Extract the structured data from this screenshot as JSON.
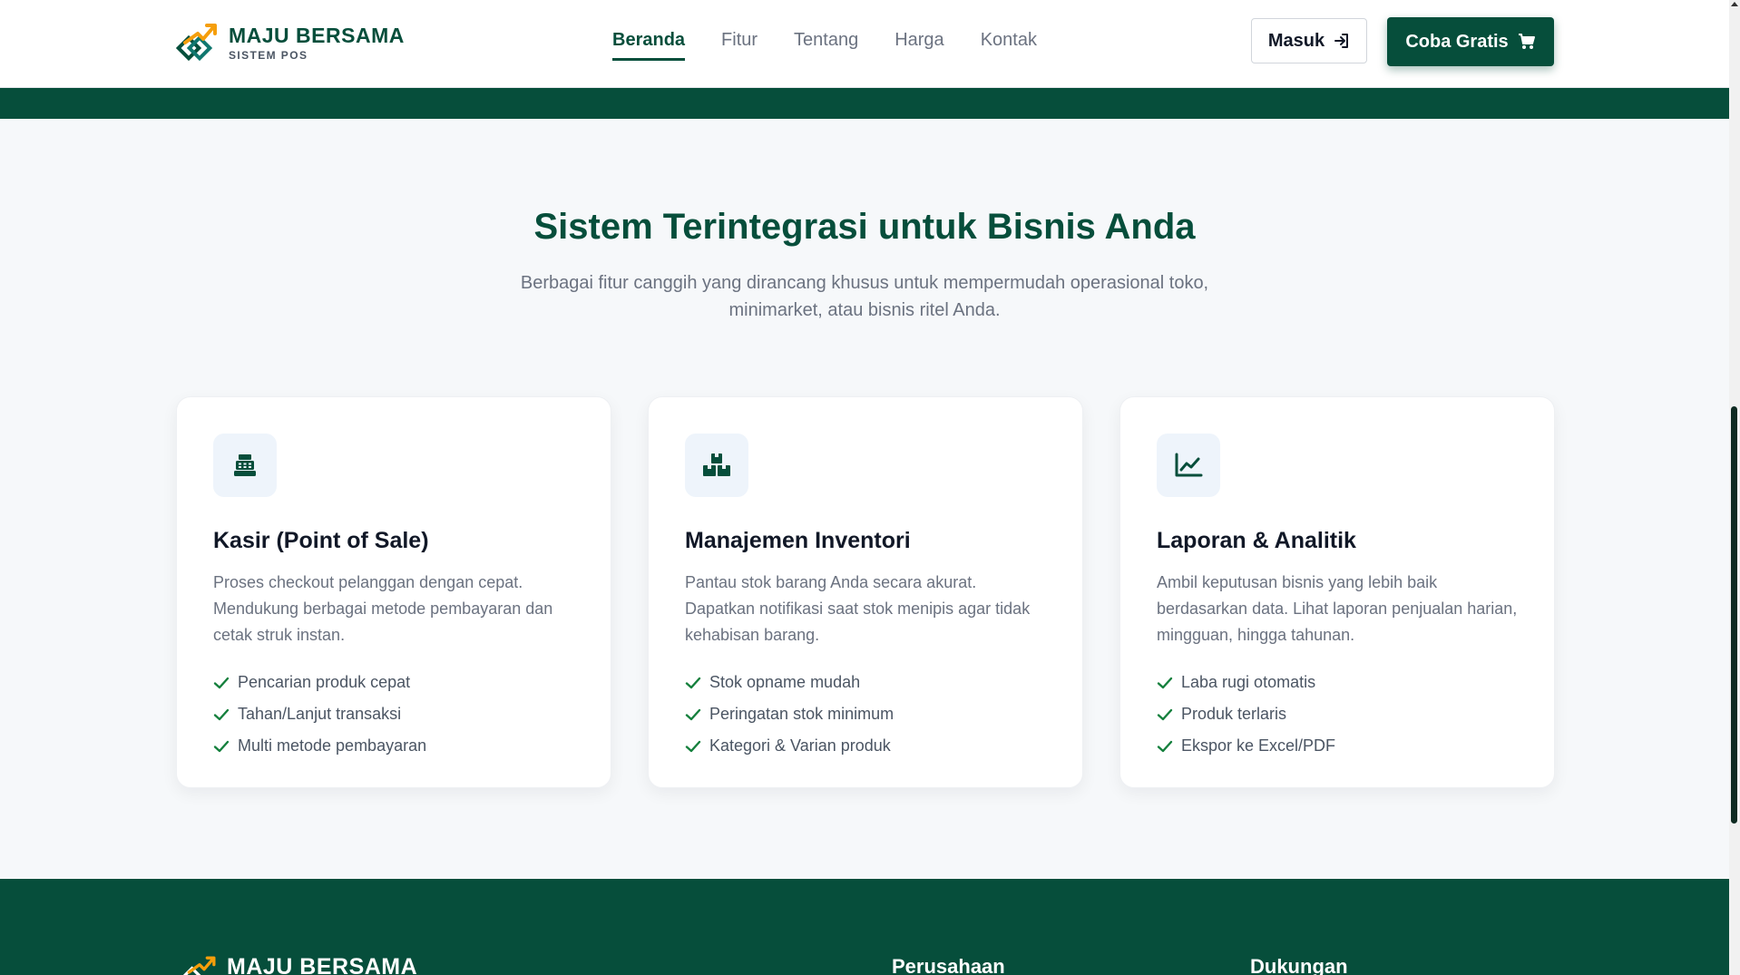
{
  "brand": {
    "name": "MAJU BERSAMA",
    "subtitle": "SISTEM POS"
  },
  "nav": {
    "items": [
      {
        "label": "Beranda",
        "active": true
      },
      {
        "label": "Fitur",
        "active": false
      },
      {
        "label": "Tentang",
        "active": false
      },
      {
        "label": "Harga",
        "active": false
      },
      {
        "label": "Kontak",
        "active": false
      }
    ],
    "login_label": "Masuk",
    "trial_label": "Coba Gratis"
  },
  "section": {
    "title": "Sistem Terintegrasi untuk Bisnis Anda",
    "description": "Berbagai fitur canggih yang dirancang khusus untuk mempermudah operasional toko, minimarket, atau bisnis ritel Anda."
  },
  "cards": [
    {
      "icon": "cash-register-icon",
      "title": "Kasir (Point of Sale)",
      "description": "Proses checkout pelanggan dengan cepat. Mendukung berbagai metode pembayaran dan cetak struk instan.",
      "features": [
        "Pencarian produk cepat",
        "Tahan/Lanjut transaksi",
        "Multi metode pembayaran"
      ]
    },
    {
      "icon": "boxes-icon",
      "title": "Manajemen Inventori",
      "description": "Pantau stok barang Anda secara akurat. Dapatkan notifikasi saat stok menipis agar tidak kehabisan barang.",
      "features": [
        "Stok opname mudah",
        "Peringatan stok minimum",
        "Kategori & Varian produk"
      ]
    },
    {
      "icon": "line-chart-icon",
      "title": "Laporan & Analitik",
      "description": "Ambil keputusan bisnis yang lebih baik berdasarkan data. Lihat laporan penjualan harian, mingguan, hingga tahunan.",
      "features": [
        "Laba rugi otomatis",
        "Produk terlaris",
        "Ekspor ke Excel/PDF"
      ]
    }
  ],
  "footer": {
    "brand_name": "MAJU BERSAMA",
    "columns": [
      "Perusahaan",
      "Dukungan"
    ]
  },
  "colors": {
    "primary": "#064e3b",
    "accent": "#f59e0b",
    "check": "#15803d",
    "background": "#f6f8fa"
  }
}
